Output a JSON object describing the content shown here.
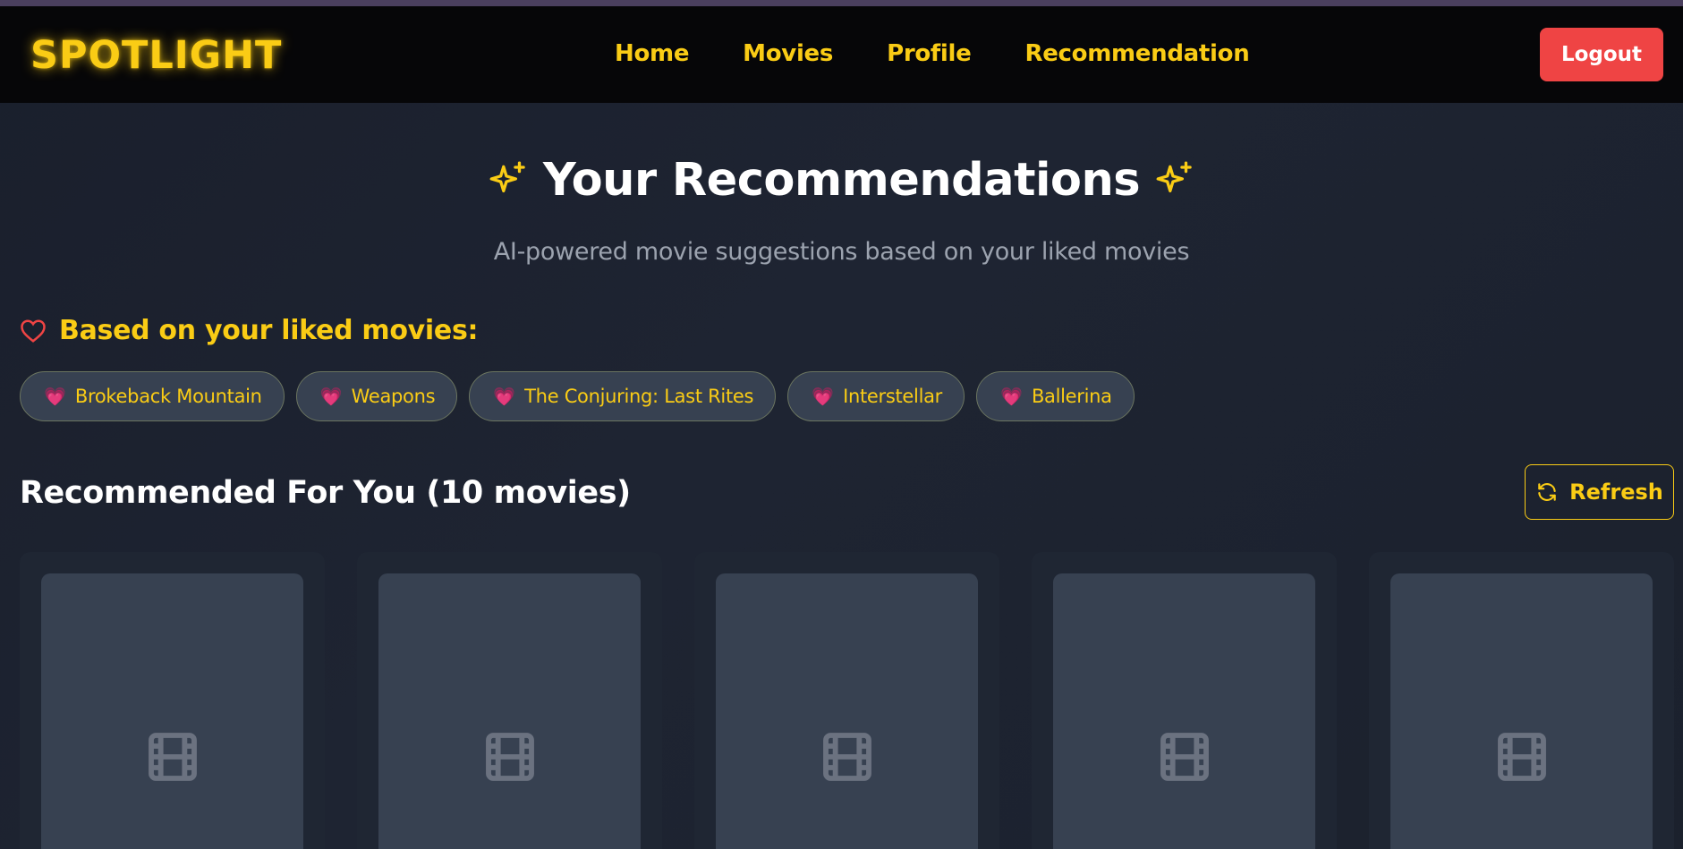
{
  "navbar": {
    "logo": "SPOTLIGHT",
    "links": [
      "Home",
      "Movies",
      "Profile",
      "Recommendation"
    ],
    "logout_label": "Logout"
  },
  "hero": {
    "title": "Your Recommendations",
    "subtitle": "AI-powered movie suggestions based on your liked movies",
    "sparkle_icon": "sparkles-icon"
  },
  "liked": {
    "heading": "Based on your liked movies:",
    "heart_icon": "heart-outline-icon",
    "chips": [
      {
        "emoji": "💗",
        "title": "Brokeback Mountain"
      },
      {
        "emoji": "💗",
        "title": "Weapons"
      },
      {
        "emoji": "💗",
        "title": "The Conjuring: Last Rites"
      },
      {
        "emoji": "💗",
        "title": "Interstellar"
      },
      {
        "emoji": "💗",
        "title": "Ballerina"
      }
    ]
  },
  "recommended": {
    "heading": "Recommended For You (10 movies)",
    "refresh_label": "Refresh",
    "refresh_icon": "refresh-icon",
    "cards": [
      {
        "placeholder_icon": "film-icon"
      },
      {
        "placeholder_icon": "film-icon"
      },
      {
        "placeholder_icon": "film-icon"
      },
      {
        "placeholder_icon": "film-icon"
      },
      {
        "placeholder_icon": "film-icon"
      }
    ]
  },
  "colors": {
    "accent": "#facc15",
    "logout": "#ef4444",
    "background": "#1e2432",
    "navbar": "#060608"
  }
}
